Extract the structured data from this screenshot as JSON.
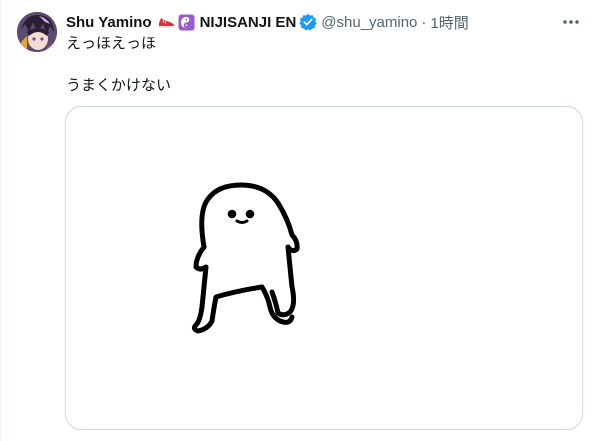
{
  "tweet": {
    "author_name": "Shu Yamino",
    "org_name": "NIJISANJI EN",
    "handle": "@shu_yamino",
    "separator": "·",
    "time": "1時間",
    "text_line1": "えっほえっほ",
    "text_line2": "うまくかけない"
  },
  "icons": {
    "shoe": "red-sneaker-emoji",
    "yinyang": "yin-yang-emoji",
    "verified": "verified-badge-icon",
    "more": "more-options-icon"
  },
  "colors": {
    "verified_blue": "#1d9bf0",
    "secondary_text": "#536471",
    "yinyang_bg": "#9b59d0"
  }
}
